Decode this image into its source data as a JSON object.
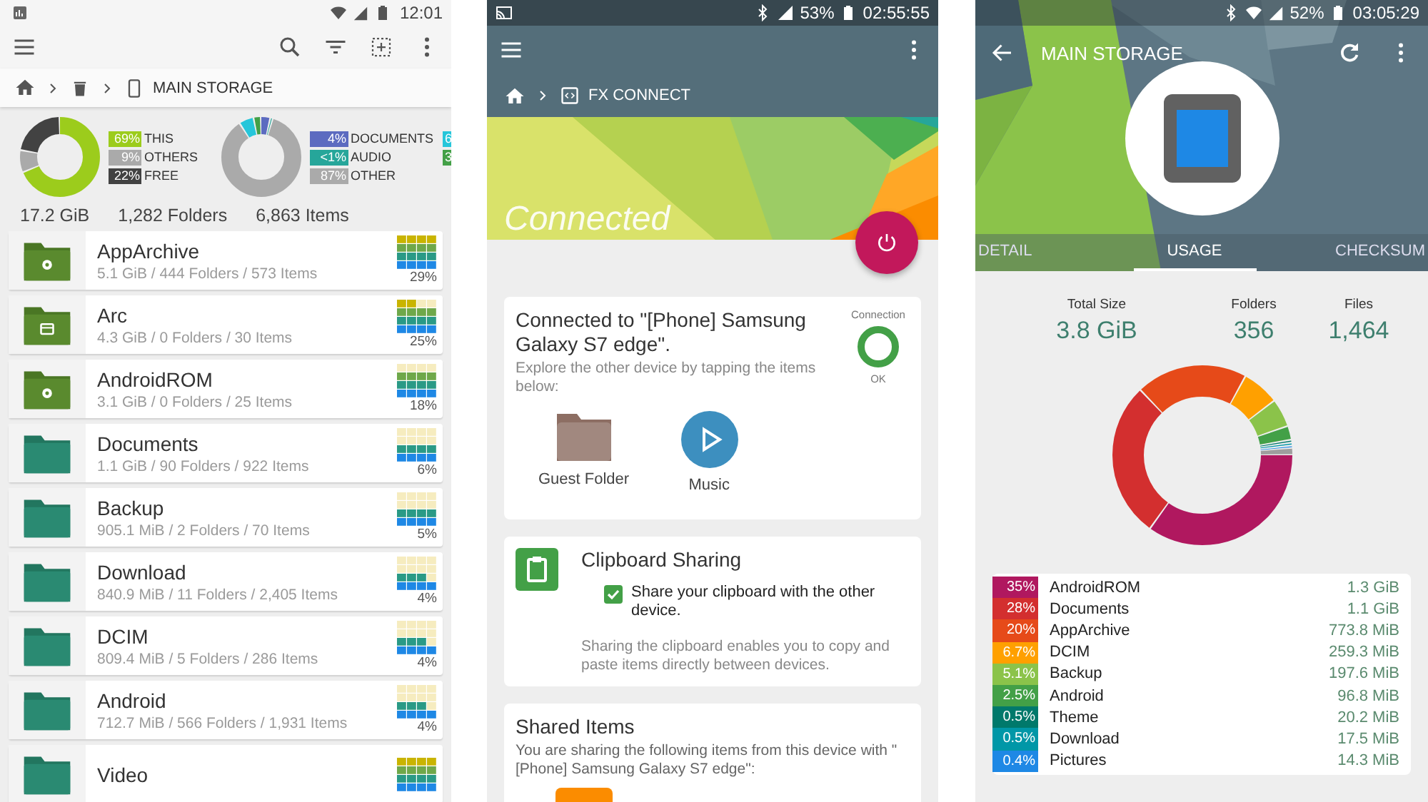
{
  "left": {
    "status": {
      "time": "12:01"
    },
    "breadcrumb": {
      "current": "MAIN STORAGE"
    },
    "legend_a": [
      {
        "pct": "69%",
        "label": "THIS",
        "color": "#9ccc1c"
      },
      {
        "pct": "9%",
        "label": "OTHERS",
        "color": "#aaaaaa"
      },
      {
        "pct": "22%",
        "label": "FREE",
        "color": "#424242"
      }
    ],
    "legend_b": [
      {
        "pct": "4%",
        "label": "DOCUMENTS",
        "color": "#5c6bc0"
      },
      {
        "pct": "<1%",
        "label": "AUDIO",
        "color": "#26a69a"
      },
      {
        "pct": "87%",
        "label": "OTHER",
        "color": "#aaaaaa"
      },
      {
        "pct": "6",
        "color": "#26c6da"
      },
      {
        "pct": "3",
        "color": "#43a047"
      }
    ],
    "totals": [
      "17.2 GiB",
      "1,282 Folders",
      "6,863 Items"
    ],
    "folders": [
      {
        "name": "AppArchive",
        "meta": "5.1 GiB / 444 Folders / 573 Items",
        "pct": "29%",
        "kind": "gear"
      },
      {
        "name": "Arc",
        "meta": "4.3 GiB / 0 Folders / 30 Items",
        "pct": "25%",
        "kind": "archive"
      },
      {
        "name": "AndroidROM",
        "meta": "3.1 GiB / 0 Folders / 25 Items",
        "pct": "18%",
        "kind": "gear"
      },
      {
        "name": "Documents",
        "meta": "1.1 GiB / 90 Folders / 922 Items",
        "pct": "6%",
        "kind": "plain"
      },
      {
        "name": "Backup",
        "meta": "905.1 MiB / 2 Folders / 70 Items",
        "pct": "5%",
        "kind": "plain"
      },
      {
        "name": "Download",
        "meta": "840.9 MiB / 11 Folders / 2,405 Items",
        "pct": "4%",
        "kind": "plain"
      },
      {
        "name": "DCIM",
        "meta": "809.4 MiB / 5 Folders / 286 Items",
        "pct": "4%",
        "kind": "plain"
      },
      {
        "name": "Android",
        "meta": "712.7 MiB / 566 Folders / 1,931 Items",
        "pct": "4%",
        "kind": "plain"
      },
      {
        "name": "Video",
        "kind": "plain"
      }
    ]
  },
  "middle": {
    "status": {
      "battery": "53%",
      "time": "02:55:55"
    },
    "breadcrumb": {
      "current": "FX CONNECT"
    },
    "banner": {
      "title": "Connected"
    },
    "connection_card": {
      "title": "Connected to \"[Phone] Samsung Galaxy S7 edge\".",
      "description": "Explore the other device by tapping the items below:",
      "indicator_label": "Connection",
      "indicator_status": "OK",
      "items": [
        {
          "label": "Guest Folder",
          "kind": "folder"
        },
        {
          "label": "Music",
          "kind": "music"
        }
      ]
    },
    "clipboard_card": {
      "title": "Clipboard Sharing",
      "checkbox": {
        "label": "Share your clipboard with the other device.",
        "checked": true
      },
      "description": "Sharing the clipboard enables you to copy and paste items directly between devices."
    },
    "shared_card": {
      "title": "Shared Items",
      "description": "You are sharing the following items from this device with \"[Phone] Samsung Galaxy S7 edge\":"
    }
  },
  "right": {
    "status": {
      "battery": "52%",
      "time": "03:05:29"
    },
    "title": "MAIN STORAGE",
    "tabs": [
      {
        "label": "DETAIL",
        "selected": false
      },
      {
        "label": "USAGE",
        "selected": true
      },
      {
        "label": "CHECKSUM",
        "selected": false
      }
    ],
    "stats": [
      {
        "label": "Total Size",
        "value": "3.8 GiB"
      },
      {
        "label": "Folders",
        "value": "356"
      },
      {
        "label": "Files",
        "value": "1,464"
      }
    ],
    "usage": [
      {
        "pct": "35%",
        "name": "AndroidROM",
        "size": "1.3 GiB",
        "color": "#b0185f"
      },
      {
        "pct": "28%",
        "name": "Documents",
        "size": "1.1 GiB",
        "color": "#d32f2f"
      },
      {
        "pct": "20%",
        "name": "AppArchive",
        "size": "773.8 MiB",
        "color": "#e64a19"
      },
      {
        "pct": "6.7%",
        "name": "DCIM",
        "size": "259.3 MiB",
        "color": "#ffa000"
      },
      {
        "pct": "5.1%",
        "name": "Backup",
        "size": "197.6 MiB",
        "color": "#8bc34a"
      },
      {
        "pct": "2.5%",
        "name": "Android",
        "size": "96.8 MiB",
        "color": "#43a047"
      },
      {
        "pct": "0.5%",
        "name": "Theme",
        "size": "20.2 MiB",
        "color": "#00796b"
      },
      {
        "pct": "0.5%",
        "name": "Download",
        "size": "17.5 MiB",
        "color": "#0097a7"
      },
      {
        "pct": "0.4%",
        "name": "Pictures",
        "size": "14.3 MiB",
        "color": "#1e88e5"
      }
    ]
  }
}
